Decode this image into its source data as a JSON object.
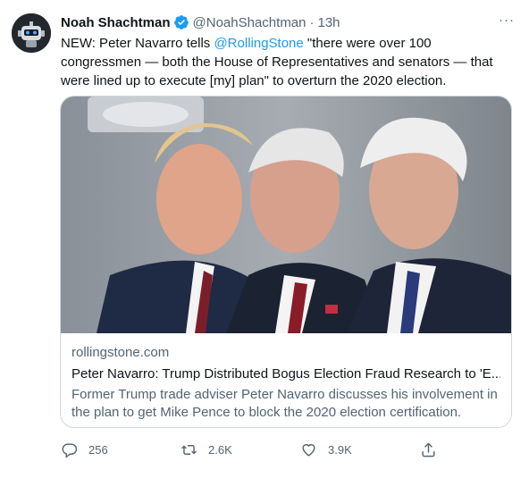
{
  "author": {
    "display_name": "Noah Shachtman",
    "handle": "@NoahShachtman",
    "separator": "·",
    "time": "13h",
    "more": "···"
  },
  "tweet": {
    "text_before": "NEW: Peter Navarro tells ",
    "mention": "@RollingStone",
    "text_after": " \"there were over 100 congressmen — both the House of Representatives and senators — that were lined up to execute [my] plan\" to overturn the 2020 election."
  },
  "card": {
    "image_icon": "photo-of-three-men",
    "domain": "rollingstone.com",
    "title": "Peter Navarro: Trump Distributed Bogus Election Fraud Research to 'E...",
    "description": "Former Trump trade adviser Peter Navarro discusses his involvement in the plan to get Mike Pence to block the 2020 election certification."
  },
  "actions": {
    "reply_count": "256",
    "retweet_count": "2.6K",
    "like_count": "3.9K",
    "reply_icon": "reply-icon",
    "retweet_icon": "retweet-icon",
    "like_icon": "heart-icon",
    "share_icon": "share-icon"
  },
  "colors": {
    "accent": "#1d9bf0",
    "secondary_text": "#536471",
    "border": "#cfd9de"
  }
}
